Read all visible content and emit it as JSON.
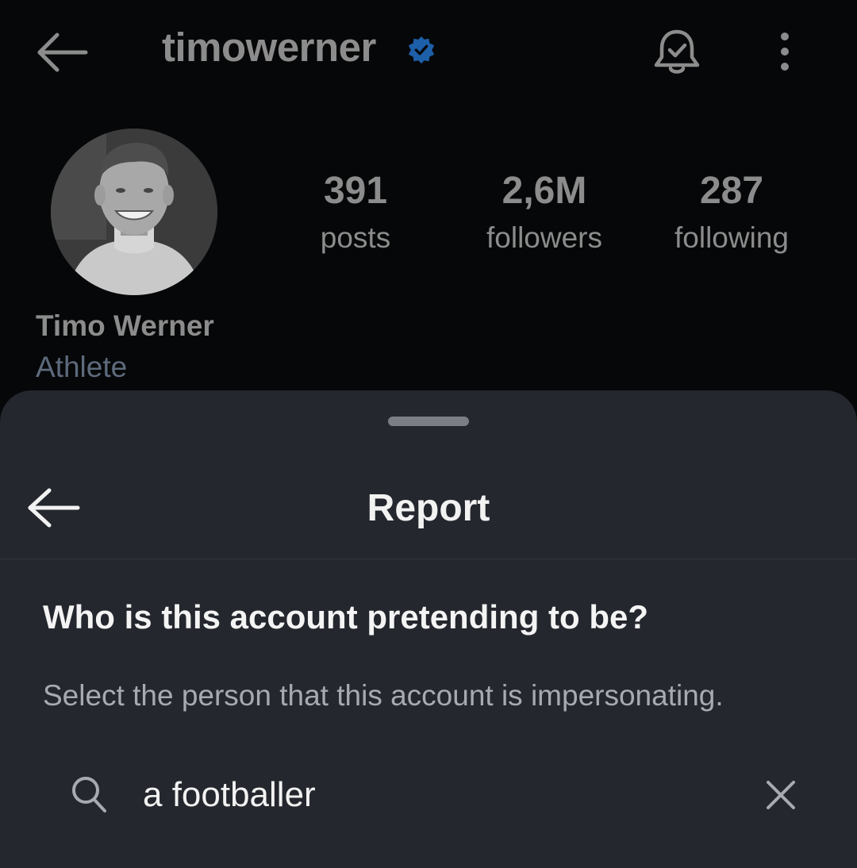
{
  "profile": {
    "username": "timowerner",
    "display_name": "Timo Werner",
    "category": "Athlete",
    "verified": true,
    "stats": [
      {
        "value": "391",
        "label": "posts"
      },
      {
        "value": "2,6M",
        "label": "followers"
      },
      {
        "value": "287",
        "label": "following"
      }
    ]
  },
  "icons": {
    "back": "arrow-left-icon",
    "verified": "verified-badge-icon",
    "notifications": "bell-check-icon",
    "more": "more-vertical-icon",
    "search": "search-icon",
    "clear": "close-icon"
  },
  "sheet": {
    "title": "Report",
    "question": "Who is this account pretending to be?",
    "subtext": "Select the person that this account is impersonating.",
    "search": {
      "value": "a footballer"
    }
  },
  "colors": {
    "background": "#060708",
    "sheet": "#24272d",
    "verified": "#1d5fa8",
    "category": "#5d6a7c"
  }
}
